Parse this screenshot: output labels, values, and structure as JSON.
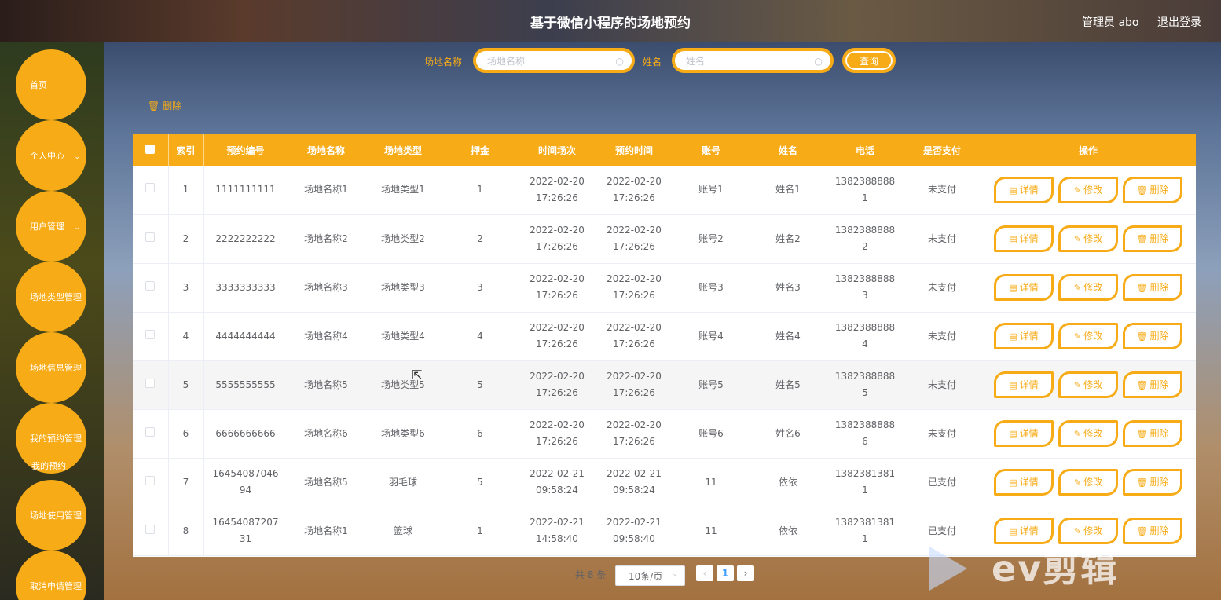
{
  "header": {
    "title": "基于微信小程序的场地预约",
    "user": "管理员 abo",
    "logout": "退出登录"
  },
  "sidebar": {
    "items": [
      {
        "label": "首页",
        "has_arrow": false
      },
      {
        "label": "个人中心",
        "has_arrow": true
      },
      {
        "label": "用户管理",
        "has_arrow": true
      },
      {
        "label": "场地类型管理",
        "has_arrow": false
      },
      {
        "label": "场地信息管理",
        "has_arrow": false
      },
      {
        "label": "我的预约管理",
        "has_arrow": false
      },
      {
        "label": "场地使用管理",
        "has_arrow": false
      },
      {
        "label": "取消申请管理",
        "has_arrow": false
      }
    ],
    "submenu": "我的预约"
  },
  "search": {
    "venue_label": "场地名称",
    "venue_placeholder": "场地名称",
    "name_label": "姓名",
    "name_placeholder": "姓名",
    "query_button": "查询"
  },
  "toolbar": {
    "batch_delete": "删除"
  },
  "table": {
    "columns": [
      "索引",
      "预约编号",
      "场地名称",
      "场地类型",
      "押金",
      "时间场次",
      "预约时间",
      "账号",
      "姓名",
      "电话",
      "是否支付",
      "操作"
    ],
    "rows": [
      [
        "1",
        "1111111111",
        "场地名称1",
        "场地类型1",
        "1",
        "2022-02-20\n17:26:26",
        "2022-02-20\n17:26:26",
        "账号1",
        "姓名1",
        "1382388888\n1",
        "未支付"
      ],
      [
        "2",
        "2222222222",
        "场地名称2",
        "场地类型2",
        "2",
        "2022-02-20\n17:26:26",
        "2022-02-20\n17:26:26",
        "账号2",
        "姓名2",
        "1382388888\n2",
        "未支付"
      ],
      [
        "3",
        "3333333333",
        "场地名称3",
        "场地类型3",
        "3",
        "2022-02-20\n17:26:26",
        "2022-02-20\n17:26:26",
        "账号3",
        "姓名3",
        "1382388888\n3",
        "未支付"
      ],
      [
        "4",
        "4444444444",
        "场地名称4",
        "场地类型4",
        "4",
        "2022-02-20\n17:26:26",
        "2022-02-20\n17:26:26",
        "账号4",
        "姓名4",
        "1382388888\n4",
        "未支付"
      ],
      [
        "5",
        "5555555555",
        "场地名称5",
        "场地类型5",
        "5",
        "2022-02-20\n17:26:26",
        "2022-02-20\n17:26:26",
        "账号5",
        "姓名5",
        "1382388888\n5",
        "未支付"
      ],
      [
        "6",
        "6666666666",
        "场地名称6",
        "场地类型6",
        "6",
        "2022-02-20\n17:26:26",
        "2022-02-20\n17:26:26",
        "账号6",
        "姓名6",
        "1382388888\n6",
        "未支付"
      ],
      [
        "7",
        "16454087046\n94",
        "场地名称5",
        "羽毛球",
        "5",
        "2022-02-21\n09:58:24",
        "2022-02-21\n09:58:24",
        "11",
        "依依",
        "1382381381\n1",
        "已支付"
      ],
      [
        "8",
        "16454087207\n31",
        "场地名称1",
        "篮球",
        "1",
        "2022-02-21\n14:58:40",
        "2022-02-21\n09:58:40",
        "11",
        "依依",
        "1382381381\n1",
        "已支付"
      ]
    ],
    "actions": [
      "详情",
      "修改",
      "删除"
    ]
  },
  "pagination": {
    "total": "共 8 条",
    "page_size": "10条/页",
    "current_page": "1"
  },
  "watermark": "ev剪辑",
  "colors": {
    "accent": "#f7ab16"
  }
}
